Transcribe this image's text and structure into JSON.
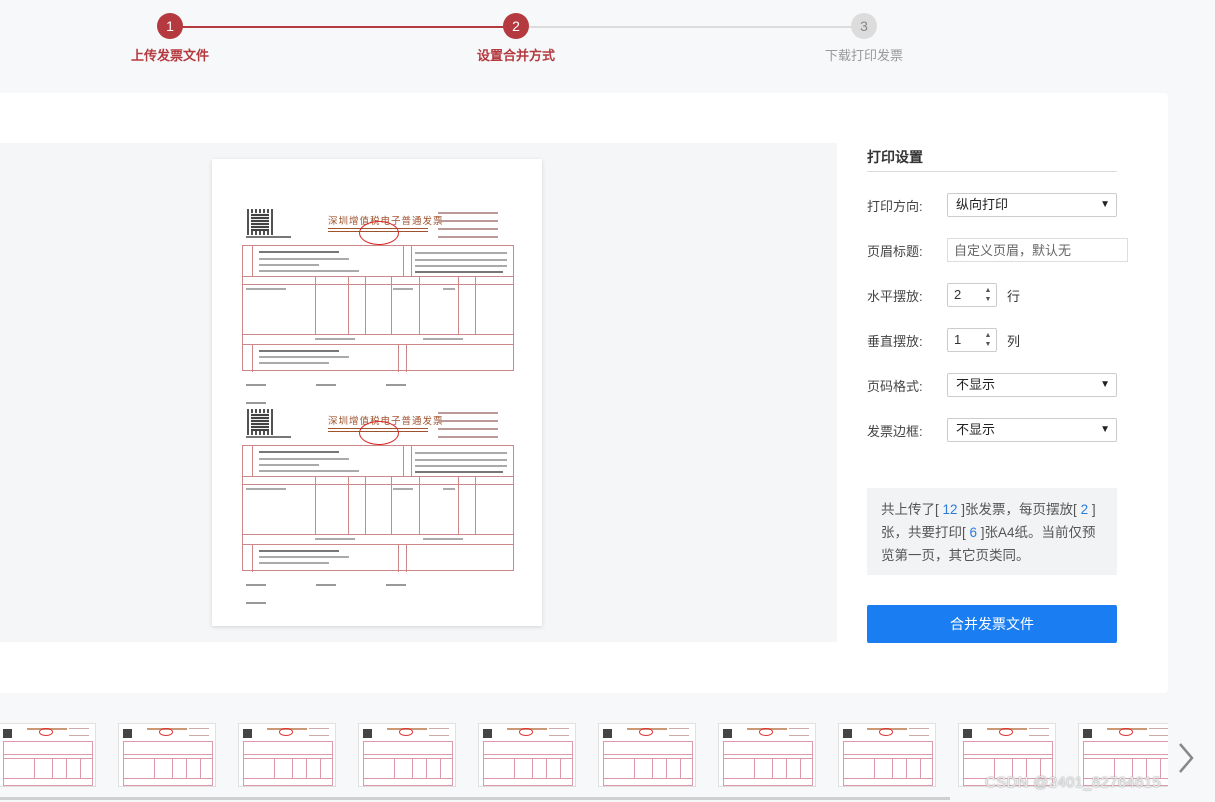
{
  "steps": [
    {
      "number": "1",
      "label": "上传发票文件",
      "state": "done"
    },
    {
      "number": "2",
      "label": "设置合并方式",
      "state": "active"
    },
    {
      "number": "3",
      "label": "下载打印发票",
      "state": "pending"
    }
  ],
  "invoice_preview": {
    "title": "深圳增值税电子普通发票",
    "count_on_page": 2
  },
  "settings": {
    "title": "打印设置",
    "orientation": {
      "label": "打印方向:",
      "value": "纵向打印"
    },
    "header_title": {
      "label": "页眉标题:",
      "placeholder": "自定义页眉，默认无"
    },
    "horizontal": {
      "label": "水平摆放:",
      "value": "2",
      "unit": "行"
    },
    "vertical": {
      "label": "垂直摆放:",
      "value": "1",
      "unit": "列"
    },
    "page_number": {
      "label": "页码格式:",
      "value": "不显示"
    },
    "border": {
      "label": "发票边框:",
      "value": "不显示"
    }
  },
  "info": {
    "p1": "共上传了[ ",
    "uploaded": "12",
    "p2": " ]张发票，每页摆放[ ",
    "per_page": "2",
    "p3": " ]张，共要打印[ ",
    "sheets": "6",
    "p4": " ]张A4纸。当前仅预览第一页，其它页类同。"
  },
  "merge_button": "合并发票文件",
  "thumbnails_count": 10,
  "watermark": "CSDN @2401_82764615",
  "colors": {
    "step_active": "#b53a3f",
    "step_pending": "#dcdcdc",
    "primary_button": "#1a7ef2",
    "highlight_number": "#2b7bd9"
  }
}
